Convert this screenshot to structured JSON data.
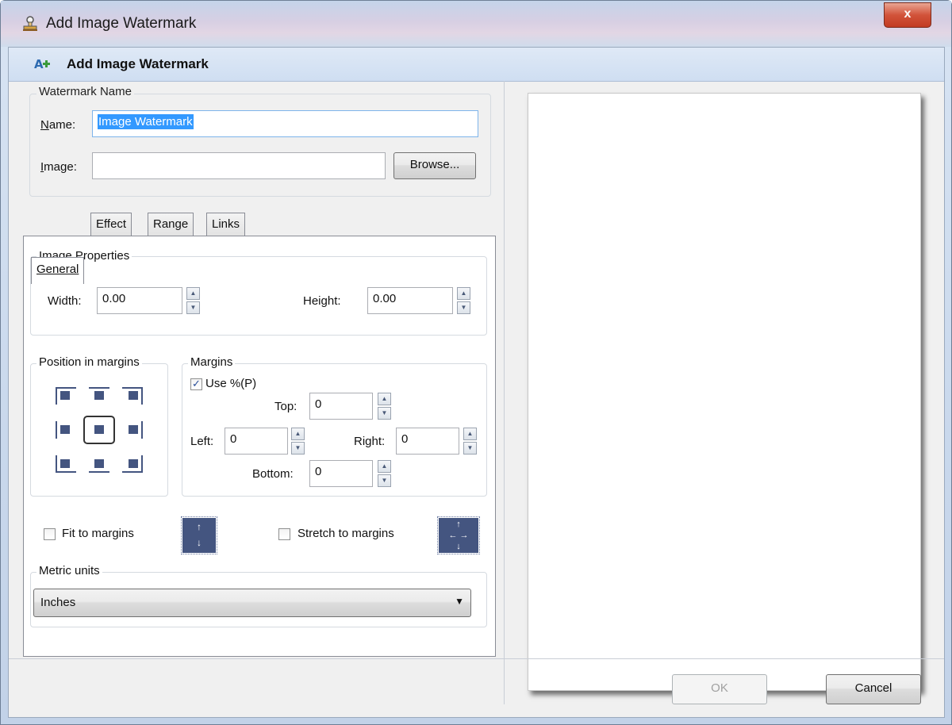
{
  "window": {
    "title": "Add Image Watermark",
    "close_label": "x"
  },
  "header": {
    "title": "Add Image Watermark"
  },
  "watermark_name_group": {
    "legend": "Watermark Name",
    "name_label": "Name:",
    "name_value": "Image Watermark",
    "image_label": "Image:",
    "image_value": "",
    "browse_label": "Browse..."
  },
  "tabs": [
    {
      "label": "General",
      "active": true
    },
    {
      "label": "Effect",
      "active": false
    },
    {
      "label": "Range",
      "active": false
    },
    {
      "label": "Links",
      "active": false
    }
  ],
  "image_properties": {
    "legend": "Image Properties",
    "width_label": "Width:",
    "width_value": "0.00",
    "height_label": "Height:",
    "height_value": "0.00"
  },
  "position": {
    "legend": "Position in margins",
    "selected": "center"
  },
  "margins": {
    "legend": "Margins",
    "use_percent_label": "Use %(P)",
    "use_percent_checked": true,
    "top_label": "Top:",
    "top_value": "0",
    "left_label": "Left:",
    "left_value": "0",
    "right_label": "Right:",
    "right_value": "0",
    "bottom_label": "Bottom:",
    "bottom_value": "0"
  },
  "fit": {
    "fit_label": "Fit to margins",
    "fit_checked": false,
    "stretch_label": "Stretch to margins",
    "stretch_checked": false
  },
  "metric_units": {
    "legend": "Metric units",
    "selected": "Inches"
  },
  "footer": {
    "ok_label": "OK",
    "ok_enabled": false,
    "cancel_label": "Cancel"
  },
  "colors": {
    "accent": "#445580",
    "selection": "#3399ff",
    "close_button": "#c23b22"
  }
}
